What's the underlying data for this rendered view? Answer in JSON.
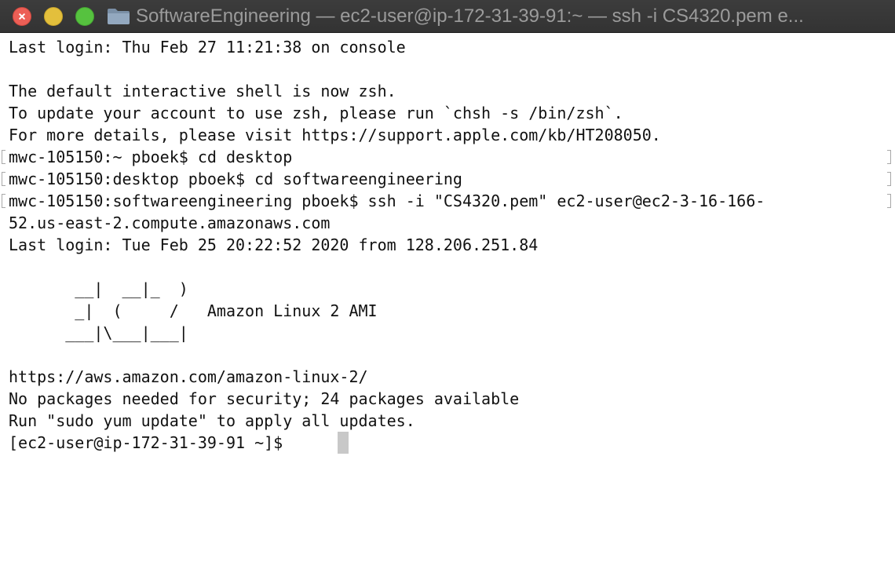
{
  "window": {
    "title": "SoftwareEngineering — ec2-user@ip-172-31-39-91:~ — ssh -i CS4320.pem e...",
    "colors": {
      "titlebar": "#373737",
      "title_text": "#9b9b9b",
      "close": "#ec5f56",
      "minimize": "#e3bf3c",
      "zoom": "#56c23f",
      "background": "#ffffff",
      "text": "#111111",
      "cursor": "#c8c8c8"
    },
    "icons": [
      "close-button",
      "minimize-button",
      "zoom-button",
      "folder-icon"
    ]
  },
  "terminal": {
    "lines": [
      "Last login: Thu Feb 27 11:21:38 on console",
      "",
      "The default interactive shell is now zsh.",
      "To update your account to use zsh, please run `chsh -s /bin/zsh`.",
      "For more details, please visit https://support.apple.com/kb/HT208050.",
      "mwc-105150:~ pboek$ cd desktop",
      "mwc-105150:desktop pboek$ cd softwareengineering",
      "mwc-105150:softwareengineering pboek$ ssh -i \"CS4320.pem\" ec2-user@ec2-3-16-166-",
      "52.us-east-2.compute.amazonaws.com",
      "Last login: Tue Feb 25 20:22:52 2020 from 128.206.251.84",
      "",
      "       __|  __|_  )",
      "       _|  (     /   Amazon Linux 2 AMI",
      "      ___|\\___|___|",
      "",
      "https://aws.amazon.com/amazon-linux-2/",
      "No packages needed for security; 24 packages available",
      "Run \"sudo yum update\" to apply all updates.",
      "[ec2-user@ip-172-31-39-91 ~]$ "
    ]
  }
}
